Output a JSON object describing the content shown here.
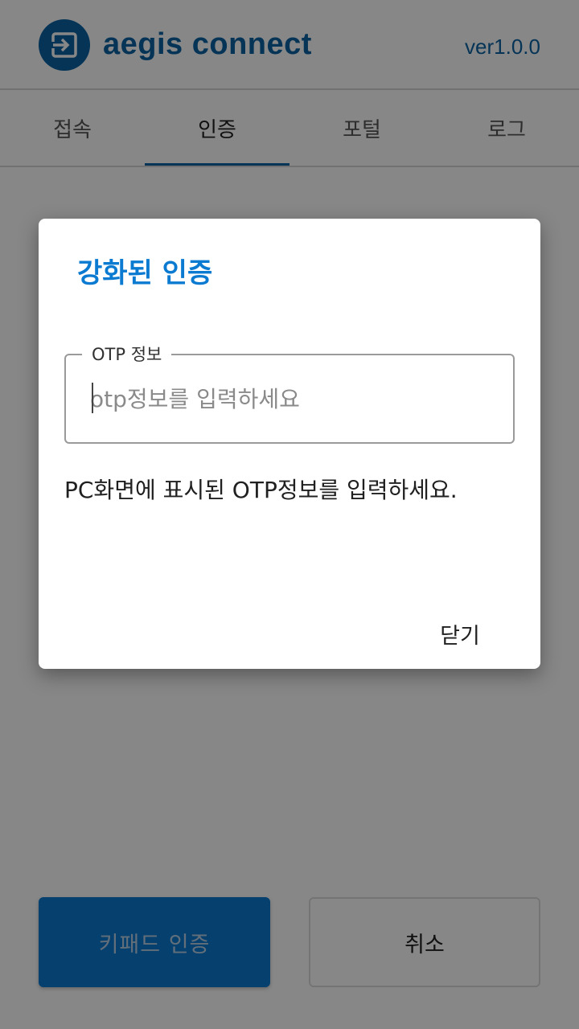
{
  "app": {
    "title": "aegis connect",
    "version": "ver1.0.0",
    "brand_color": "#0b62a3",
    "logo_icon": "login-arrow-icon"
  },
  "tabs": [
    {
      "label": "접속",
      "active": false
    },
    {
      "label": "인증",
      "active": true
    },
    {
      "label": "포털",
      "active": false
    },
    {
      "label": "로그",
      "active": false
    }
  ],
  "actions": {
    "keypad_label": "키패드 인증",
    "cancel_label": "취소"
  },
  "dialog": {
    "title": "강화된 인증",
    "otp_label": "OTP 정보",
    "otp_value": "",
    "otp_placeholder": "otp정보를 입력하세요",
    "message": "PC화면에 표시된 OTP정보를 입력하세요.",
    "close_label": "닫기",
    "accent_color": "#0b7ad1"
  }
}
